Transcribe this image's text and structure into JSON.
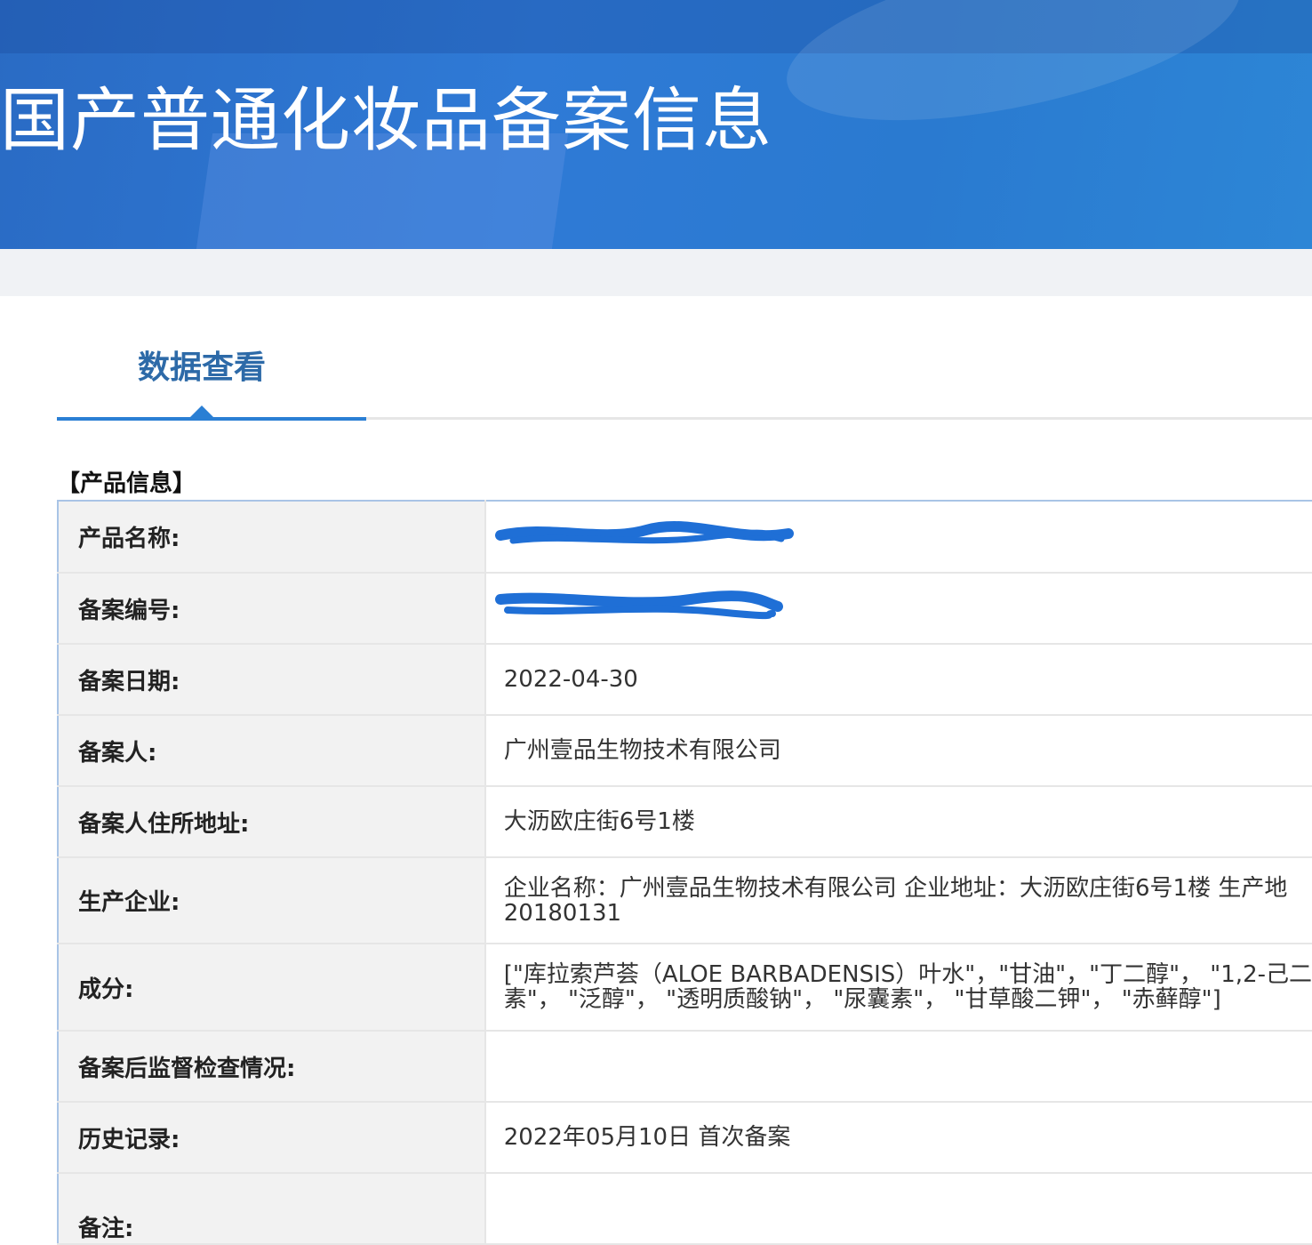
{
  "banner": {
    "title": "国产普通化妆品备案信息"
  },
  "tab": {
    "label": "数据查看"
  },
  "section": {
    "title": "【产品信息】"
  },
  "rows": [
    {
      "label": "产品名称:",
      "value": ""
    },
    {
      "label": "备案编号:",
      "value": ""
    },
    {
      "label": "备案日期:",
      "value": "2022-04-30"
    },
    {
      "label": "备案人:",
      "value": "广州壹品生物技术有限公司"
    },
    {
      "label": "备案人住所地址:",
      "value": "大沥欧庄街6号1楼"
    },
    {
      "label": "生产企业:",
      "value_line1": "企业名称：广州壹品生物技术有限公司 企业地址：大沥欧庄街6号1楼 生产地",
      "value_line2": "20180131"
    },
    {
      "label": "成分:",
      "value_line1": "[\"库拉索芦荟（ALOE BARBADENSIS）叶水\"，\"甘油\"，\"丁二醇\"， \"1,2-己二",
      "value_line2": "素\"， \"泛醇\"， \"透明质酸钠\"， \"尿囊素\"， \"甘草酸二钾\"， \"赤藓醇\"]"
    },
    {
      "label": "备案后监督检查情况:",
      "value": ""
    },
    {
      "label": "历史记录:",
      "value": "2022年05月10日 首次备案"
    },
    {
      "label": "备注:",
      "value": ""
    }
  ],
  "colors": {
    "banner": "#2f7ad6",
    "tab_text": "#2d6aa8",
    "tab_underline": "#2a7fd4",
    "label_bg": "#f2f2f2",
    "redaction": "#1f6fd6"
  },
  "redactions": [
    {
      "row": 0,
      "description": "scribble over product name"
    },
    {
      "row": 1,
      "description": "scribble over filing number"
    }
  ]
}
